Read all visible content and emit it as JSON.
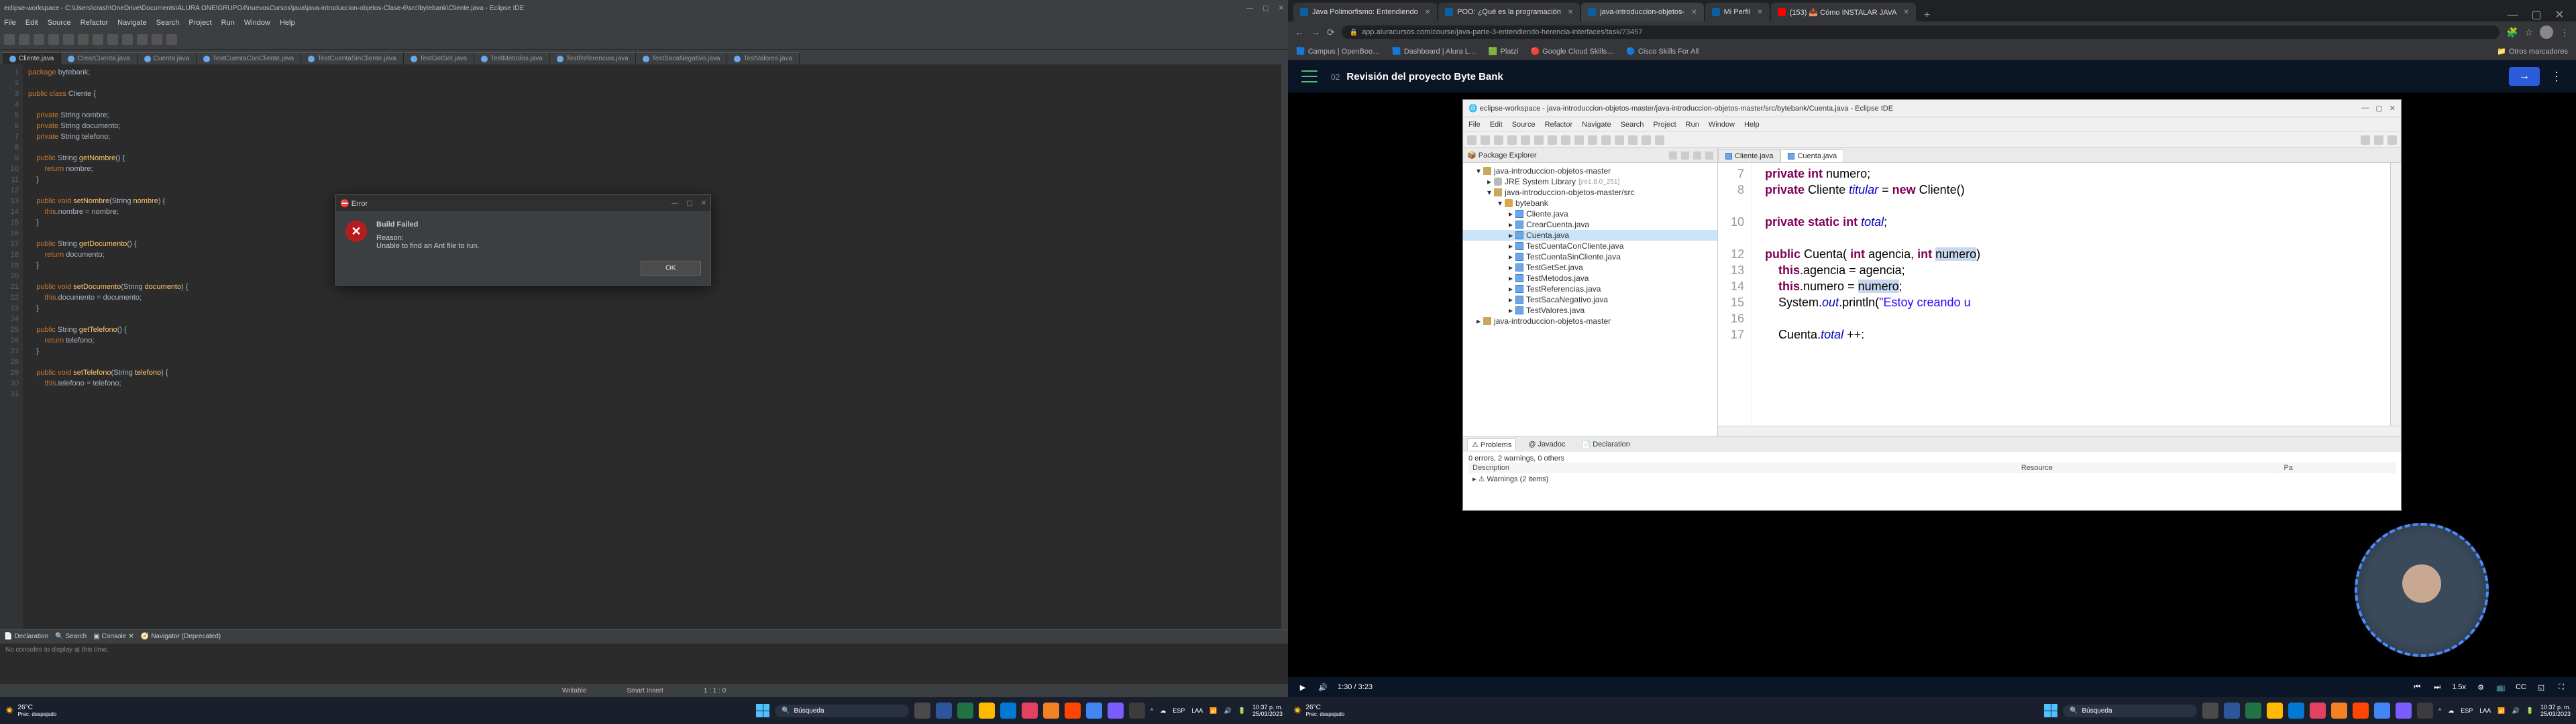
{
  "left": {
    "titlebar": "eclipse-workspace - C:\\Users\\crash\\OneDrive\\Documents\\ALURA ONE\\GRUPO4\\nuevosCursos\\java\\java-introduccion-objetos-Clase-6\\src\\bytebank\\Cliente.java - Eclipse IDE",
    "menu": [
      "File",
      "Edit",
      "Source",
      "Refactor",
      "Navigate",
      "Search",
      "Project",
      "Run",
      "Window",
      "Help"
    ],
    "tabs": [
      "Cliente.java",
      "CrearCuenta.java",
      "Cuenta.java",
      "TestCuentaConCliente.java",
      "TestCuentaSinCliente.java",
      "TestGetSet.java",
      "TestMetodos.java",
      "TestReferencias.java",
      "TestSacaNegativo.java",
      "TestValores.java"
    ],
    "gutter": [
      "1",
      "2",
      "3",
      "4",
      "5",
      "6",
      "7",
      "8",
      "9",
      "10",
      "11",
      "12",
      "13",
      "14",
      "15",
      "16",
      "17",
      "18",
      "19",
      "20",
      "21",
      "22",
      "23",
      "24",
      "25",
      "26",
      "27",
      "28",
      "29",
      "30",
      "31"
    ],
    "code": {
      "l1a": "package",
      "l1b": " bytebank;",
      "l3a": "public class",
      "l3b": " Cliente {",
      "l5a": "    private",
      "l5b": " String nombre;",
      "l6a": "    private",
      "l6b": " String documento;",
      "l7a": "    private",
      "l7b": " String telefono;",
      "l9a": "    public",
      "l9b": " String ",
      "l9c": "getNombre",
      "l9d": "() {",
      "l10a": "        return",
      "l10b": " nombre;",
      "l11": "    }",
      "l13a": "    public void ",
      "l13b": "setNombre",
      "l13c": "(String ",
      "l13d": "nombre",
      "l13e": ") {",
      "l14a": "        this",
      "l14b": ".nombre = nombre;",
      "l15": "    }",
      "l17a": "    public",
      "l17b": " String ",
      "l17c": "getDocumento",
      "l17d": "() {",
      "l18a": "        return",
      "l18b": " documento;",
      "l19": "    }",
      "l21a": "    public void ",
      "l21b": "setDocumento",
      "l21c": "(String ",
      "l21d": "documento",
      "l21e": ") {",
      "l22a": "        this",
      "l22b": ".documento = documento;",
      "l23": "    }",
      "l25a": "    public",
      "l25b": " String ",
      "l25c": "getTelefono",
      "l25d": "() {",
      "l26a": "        return",
      "l26b": " telefono;",
      "l27": "    }",
      "l29a": "    public void ",
      "l29b": "setTelefono",
      "l29c": "(String ",
      "l29d": "telefono",
      "l29e": ") {",
      "l30a": "        this",
      "l30b": ".telefono = telefono;"
    },
    "bottom_tabs": [
      "Declaration",
      "Search",
      "Console",
      "Navigator (Deprecated)"
    ],
    "console_msg": "No consoles to display at this time.",
    "status": {
      "writable": "Writable",
      "insert": "Smart Insert",
      "pos": "1 : 1 : 0"
    },
    "error": {
      "title": "Error",
      "heading": "Build Failed",
      "reason_label": "Reason:",
      "reason": "Unable to find an Ant file to run.",
      "ok": "OK"
    }
  },
  "right": {
    "chrome_tabs": [
      {
        "label": "Java Polimorfismo: Entendiendo",
        "active": false,
        "fav": "#0b5fa5"
      },
      {
        "label": "POO: ¿Qué es la programación",
        "active": false,
        "fav": "#0b5fa5"
      },
      {
        "label": "java-introduccion-objetos-",
        "active": true,
        "fav": "#0b5fa5"
      },
      {
        "label": "Mi Perfil",
        "active": false,
        "fav": "#0b5fa5"
      },
      {
        "label": "(153) 📥 Cómo INSTALAR JAVA",
        "active": false,
        "fav": "#ff0000"
      }
    ],
    "url": "app.aluracursos.com/course/java-parte-3-entendiendo-herencia-interfaces/task/73457",
    "bookmarks": [
      "Campus | OpenBoo…",
      "Dashboard | Alura L…",
      "Platzi",
      "Google Cloud Skills…",
      "Cisco Skills For All"
    ],
    "bookmarks_right": "Otros marcadores",
    "lesson_num": "02",
    "lesson_title": "Revisión del proyecto Byte Bank",
    "eclipse_title": "eclipse-workspace - java-introduccion-objetos-master/java-introduccion-objetos-master/src/bytebank/Cuenta.java - Eclipse IDE",
    "eclipse_menu": [
      "File",
      "Edit",
      "Source",
      "Refactor",
      "Navigate",
      "Search",
      "Project",
      "Run",
      "Window",
      "Help"
    ],
    "pkg_header": "Package Explorer",
    "tree": {
      "proj": "java-introduccion-objetos-master",
      "jre": "JRE System Library",
      "jre_ver": "[jre1.8.0_251]",
      "src": "java-introduccion-objetos-master/src",
      "pkg": "bytebank",
      "files": [
        "Cliente.java",
        "CrearCuenta.java",
        "Cuenta.java",
        "TestCuentaConCliente.java",
        "TestCuentaSinCliente.java",
        "TestGetSet.java",
        "TestMetodos.java",
        "TestReferencias.java",
        "TestSacaNegativo.java",
        "TestValores.java"
      ],
      "proj2": "java-introduccion-objetos-master"
    },
    "editor_tabs": [
      "Cliente.java",
      "Cuenta.java"
    ],
    "gutter": [
      "7",
      "8",
      "",
      "10",
      "",
      "12",
      "13",
      "14",
      "15",
      "16",
      "17"
    ],
    "src": {
      "l7": {
        "a": "private int",
        "b": " numero;"
      },
      "l8": {
        "a": "private",
        "b": " Cliente ",
        "c": "titular",
        "d": " = ",
        "e": "new",
        "f": " Cliente()"
      },
      "l10": {
        "a": "private static int ",
        "b": "total",
        "c": ";"
      },
      "l12": {
        "a": "public",
        "b": " Cuenta( ",
        "c": "int",
        "d": " agencia, ",
        "e": "int",
        "f": " ",
        "g": "numero",
        "h": ")"
      },
      "l13": {
        "a": "    this",
        "b": ".agencia = agencia;"
      },
      "l14": {
        "a": "    this",
        "b": ".numero = ",
        "c": "numero",
        ";": ";"
      },
      "l15": {
        "a": "    System.",
        "b": "out",
        "c": ".println(",
        "d": "\"Estoy creando u"
      },
      "l17": {
        "a": "    Cuenta.",
        "b": "total",
        "c": " ++:"
      }
    },
    "problems": {
      "tabs": [
        "Problems",
        "Javadoc",
        "Declaration"
      ],
      "summary": "0 errors, 2 warnings, 0 others",
      "cols": [
        "Description",
        "Resource",
        "Pa"
      ],
      "row": "Warnings (2 items)"
    },
    "video": {
      "time": "1:30 / 3:23",
      "speed": "1.5x"
    }
  },
  "taskbar": {
    "temp": "26°C",
    "weather": "Prec. despejado",
    "search": "Búsqueda",
    "lang": "ESP",
    "net": "LAA",
    "time": "10:37 p. m.",
    "date": "25/03/2023"
  },
  "colors": {
    "tb_icons": [
      "#2b579a",
      "#217346",
      "#b7472a",
      "#ffb900",
      "#e4405f",
      "#f48024",
      "#ff4500",
      "#00aff0",
      "#7b5cff",
      "#9b59b6"
    ]
  }
}
